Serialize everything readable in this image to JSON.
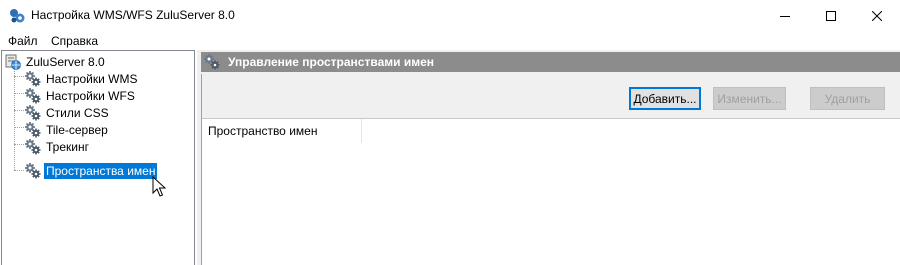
{
  "window": {
    "title": "Настройка WMS/WFS ZuluServer 8.0",
    "app_icon": "zulu-server-icon",
    "controls": [
      "minimize-icon",
      "maximize-icon",
      "close-icon"
    ]
  },
  "menu": {
    "items": [
      {
        "label": "Файл"
      },
      {
        "label": "Справка"
      }
    ]
  },
  "tree": {
    "root": {
      "label": "ZuluServer 8.0",
      "icon": "server-globe-icon"
    },
    "children": [
      {
        "label": "Настройки WMS",
        "icon": "gears-icon",
        "selected": false
      },
      {
        "label": "Настройки WFS",
        "icon": "gears-icon",
        "selected": false
      },
      {
        "label": "Стили CSS",
        "icon": "gears-icon",
        "selected": false
      },
      {
        "label": "Tile-сервер",
        "icon": "gears-icon",
        "selected": false
      },
      {
        "label": "Трекинг",
        "icon": "gears-icon",
        "selected": false
      },
      {
        "label": "Пространства имен",
        "icon": "gears-icon",
        "selected": true
      }
    ]
  },
  "panel": {
    "title": "Управление пространствами имен",
    "icon": "gears-icon",
    "buttons": {
      "add": "Добавить...",
      "edit": "Изменить...",
      "delete": "Удалить"
    },
    "list": {
      "columns": [
        "Пространство имен"
      ],
      "rows": []
    }
  },
  "colors": {
    "selection": "#0078d7",
    "panel_header": "#8c8c8c",
    "dialog_bg": "#f0f0f0"
  }
}
